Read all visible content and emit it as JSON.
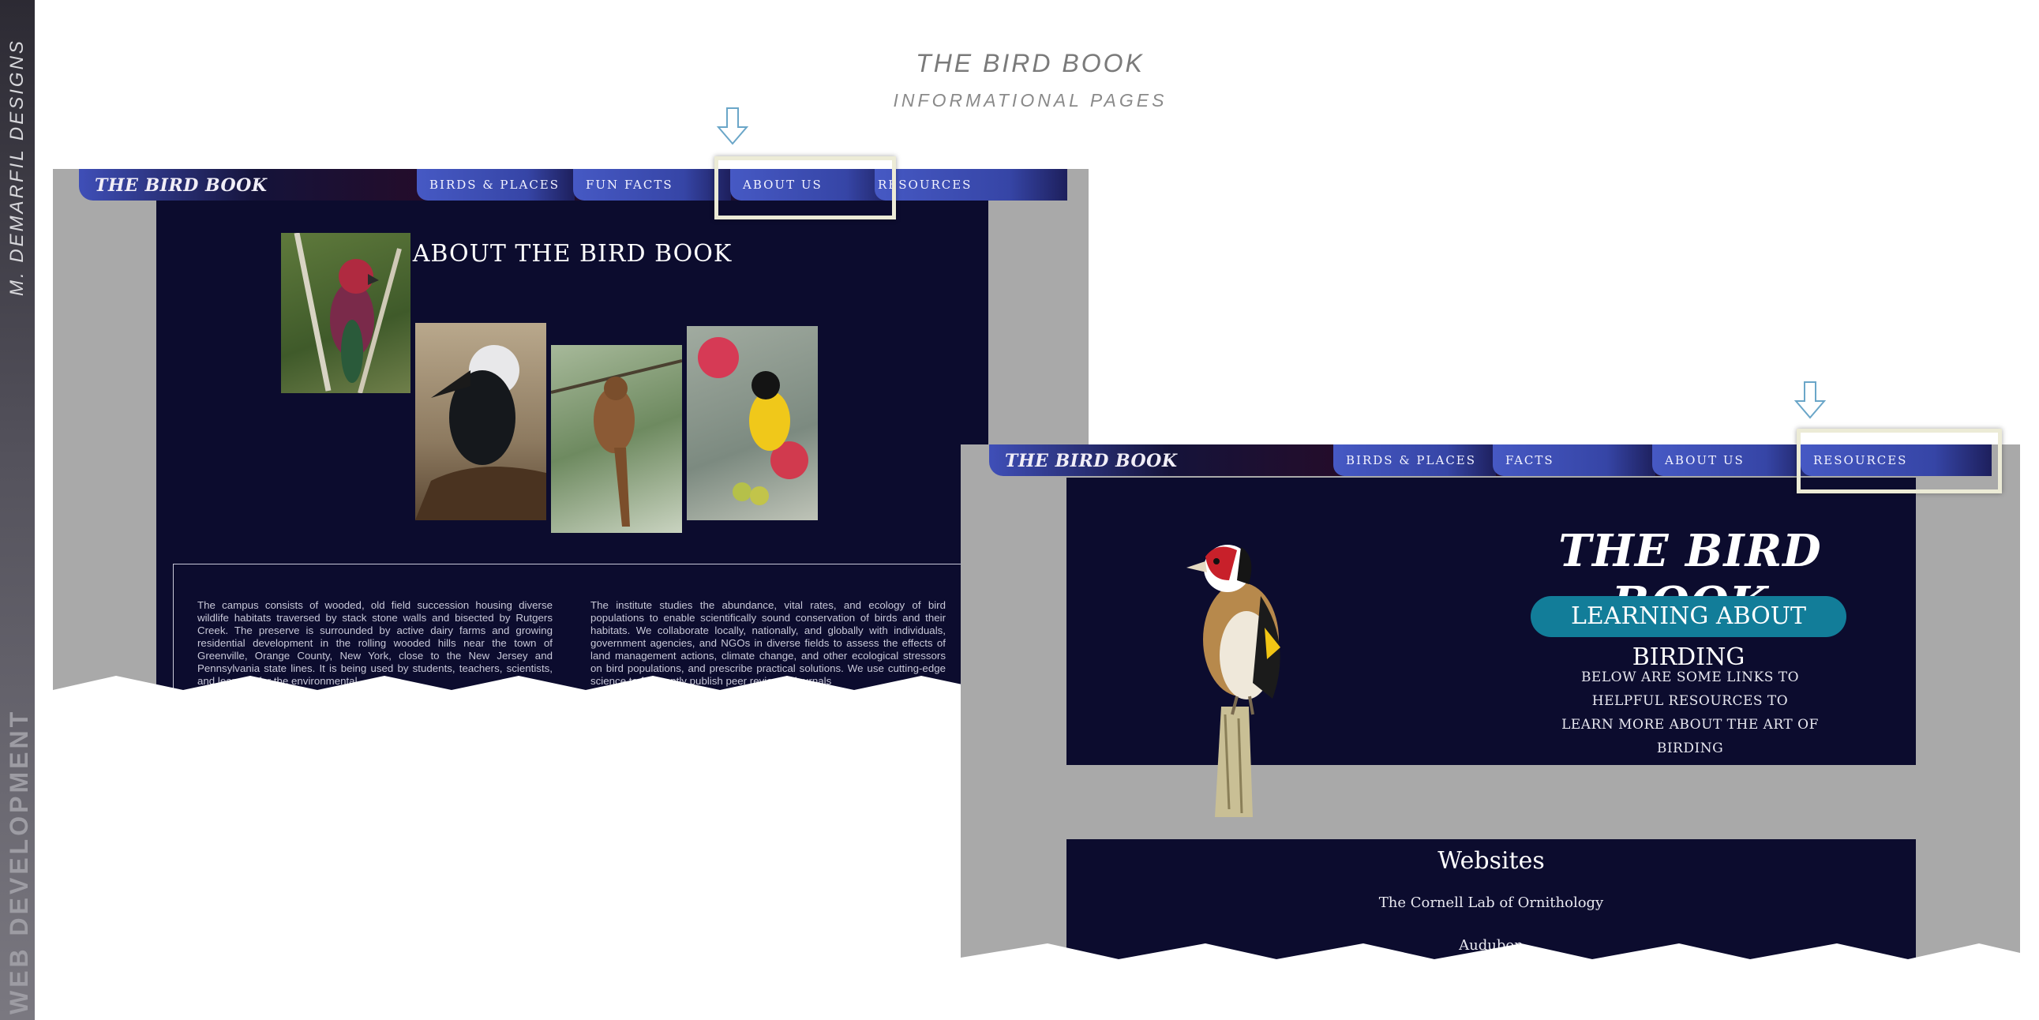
{
  "side": {
    "top_label": "M. DEMARFIL DESIGNS",
    "bottom_label": "WEB DEVELOPMENT"
  },
  "header": {
    "title": "THE BIRD BOOK",
    "subtitle": "INFORMATIONAL PAGES"
  },
  "mockup_about": {
    "logo": "THE BIRD BOOK",
    "nav": [
      "BIRDS & PLACES",
      "FUN FACTS",
      "ABOUT US",
      "RESOURCES"
    ],
    "active_tab": "ABOUT US",
    "title": "ABOUT THE BIRD BOOK",
    "photos": [
      "parrot-photo",
      "hornbill-photo",
      "cuckoo-photo",
      "oriole-photo"
    ],
    "col1": "The campus consists of wooded, old field succession housing diverse wildlife habitats traversed by stack stone walls and bisected by Rutgers Creek. The preserve is surrounded by active dairy farms and growing residential development in the rolling wooded hills near the town of Greenville, Orange County, New York, close to the New Jersey and Pennsylvania state lines. It is being used by students, teachers, scientists, and learners for the environmental",
    "col2": "The institute studies the abundance, vital rates, and ecology of bird populations to enable scientifically sound conservation of birds and their habitats. We collaborate locally, nationally, and globally with individuals, government agencies, and NGOs in diverse fields to assess the effects of land management actions, climate change, and other ecological stressors on bird populations, and prescribe practical solutions. We use cutting-edge science to frequently publish peer reviewed journals"
  },
  "mockup_resources": {
    "logo": "THE BIRD BOOK",
    "nav": [
      "BIRDS & PLACES",
      "FACTS",
      "ABOUT US",
      "RESOURCES"
    ],
    "active_tab": "RESOURCES",
    "hero_title": "THE BIRD BOOK",
    "pill": "LEARNING ABOUT BIRDING",
    "desc_line1": "BELOW ARE SOME LINKS TO HELPFUL RESOURCES TO",
    "desc_line2": "LEARN MORE ABOUT THE ART OF BIRDING",
    "sites_title": "Websites",
    "sites": [
      "The Cornell Lab of Ornithology",
      "Audubon"
    ]
  },
  "colors": {
    "nav_blue": "#3f4fb8",
    "page_dark": "#0c0c2e",
    "accent_teal": "#127d99",
    "highlight": "#ecebd6",
    "arrow": "#6aa6c8"
  }
}
